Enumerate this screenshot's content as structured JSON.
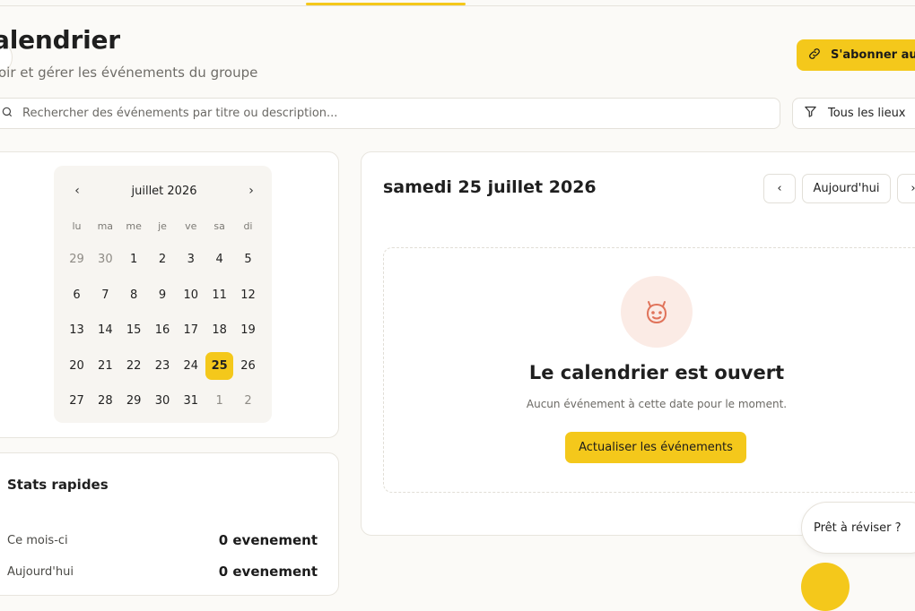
{
  "header": {
    "title": "alendrier",
    "subtitle": "oir et gérer les événements du groupe",
    "subscribe_label": "S'abonner au"
  },
  "search": {
    "placeholder": "Rechercher des événements par titre ou description..."
  },
  "filter": {
    "label": "Tous les lieux"
  },
  "mini_calendar": {
    "month_label": "juillet 2026",
    "weekdays": [
      "lu",
      "ma",
      "me",
      "je",
      "ve",
      "sa",
      "di"
    ],
    "weeks": [
      [
        "29",
        "30",
        "1",
        "2",
        "3",
        "4",
        "5"
      ],
      [
        "6",
        "7",
        "8",
        "9",
        "10",
        "11",
        "12"
      ],
      [
        "13",
        "14",
        "15",
        "16",
        "17",
        "18",
        "19"
      ],
      [
        "20",
        "21",
        "22",
        "23",
        "24",
        "25",
        "26"
      ],
      [
        "27",
        "28",
        "29",
        "30",
        "31",
        "1",
        "2"
      ]
    ],
    "selected_day": "25"
  },
  "stats": {
    "title": "Stats rapides",
    "items": [
      {
        "label": "Ce mois-ci",
        "value": "0 evenement"
      },
      {
        "label": "Aujourd'hui",
        "value": "0 evenement"
      }
    ]
  },
  "day_view": {
    "date_title": "samedi 25 juillet 2026",
    "prev_glyph": "‹",
    "today_label": "Aujourd'hui",
    "next_glyph": "›",
    "empty_title": "Le calendrier est ouvert",
    "empty_subtitle": "Aucun événement à cette date pour le moment.",
    "refresh_label": "Actualiser les événements"
  },
  "review_chip": {
    "label": "Prêt à réviser ?",
    "close_glyph": "×"
  },
  "colors": {
    "accent": "#f4c81b",
    "smile_bg": "#fbebe5",
    "smile_stroke": "#e0735a"
  },
  "icons": [
    "link-icon",
    "search-icon",
    "filter-icon",
    "smile-icon",
    "chevron-left-icon",
    "chevron-right-icon"
  ]
}
